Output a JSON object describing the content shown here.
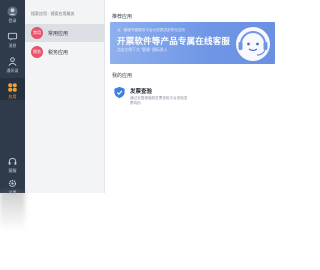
{
  "rail": {
    "items": [
      {
        "label": "登录",
        "icon": "avatar-icon"
      },
      {
        "label": "消息",
        "icon": "chat-icon"
      },
      {
        "label": "通讯录",
        "icon": "contacts-icon"
      },
      {
        "label": "应用",
        "icon": "apps-icon"
      },
      {
        "label": "客服",
        "icon": "headset-icon"
      },
      {
        "label": "设置",
        "icon": "settings-icon"
      }
    ],
    "active_index": 3
  },
  "middle": {
    "search_placeholder": "搜索应用 · 搜索应用服务",
    "items": [
      {
        "badge": "常用",
        "name": "常用应用",
        "selected": true
      },
      {
        "badge": "税务",
        "name": "税务应用",
        "selected": false
      }
    ]
  },
  "main": {
    "recommend_title": "推荐应用",
    "banner": {
      "small": "点 · 客服专属服务平台为您提供多样化支持",
      "big": "开票软件等产品专属在线客服",
      "sub": "点击左侧下方 \"客服\" 图标进入"
    },
    "my_apps_title": "我的应用",
    "card": {
      "title": "发票查验",
      "desc": "通过全国增值税发票查验平台查验发票真伪"
    }
  },
  "colors": {
    "rail_bg": "#2f3b4a",
    "accent_pink": "#e8526c",
    "banner_blue": "#6f96e6",
    "apps_orange": "#f0a030"
  }
}
